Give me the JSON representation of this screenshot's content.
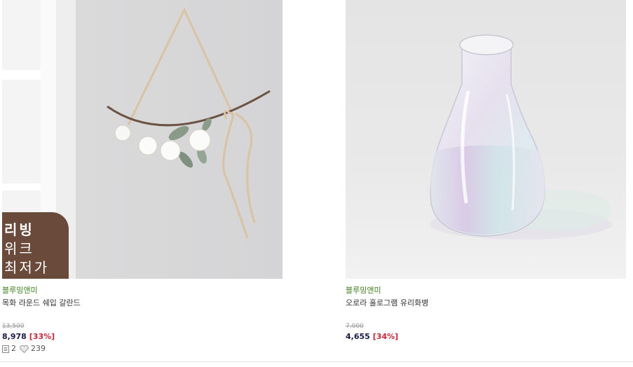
{
  "products": [
    {
      "brand": "블루밍앤미",
      "title": "목화 라운드 쉐입 갈란드",
      "original_price": "13,500",
      "sale_price": "8,978",
      "discount": "[33%]",
      "review_count": "2",
      "like_count": "239",
      "badge": {
        "line1": "리빙",
        "line2": "위크",
        "line3": "최저가"
      }
    },
    {
      "brand": "블루밍앤미",
      "title": "오로라 홀로그램 유리화병",
      "original_price": "7,000",
      "sale_price": "4,655",
      "discount": "[34%]"
    }
  ],
  "colors": {
    "brand_green": "#3f7f1f",
    "sale_navy": "#1b1b4a",
    "discount_red": "#c0283a",
    "badge_brown": "#6a4a3a"
  }
}
